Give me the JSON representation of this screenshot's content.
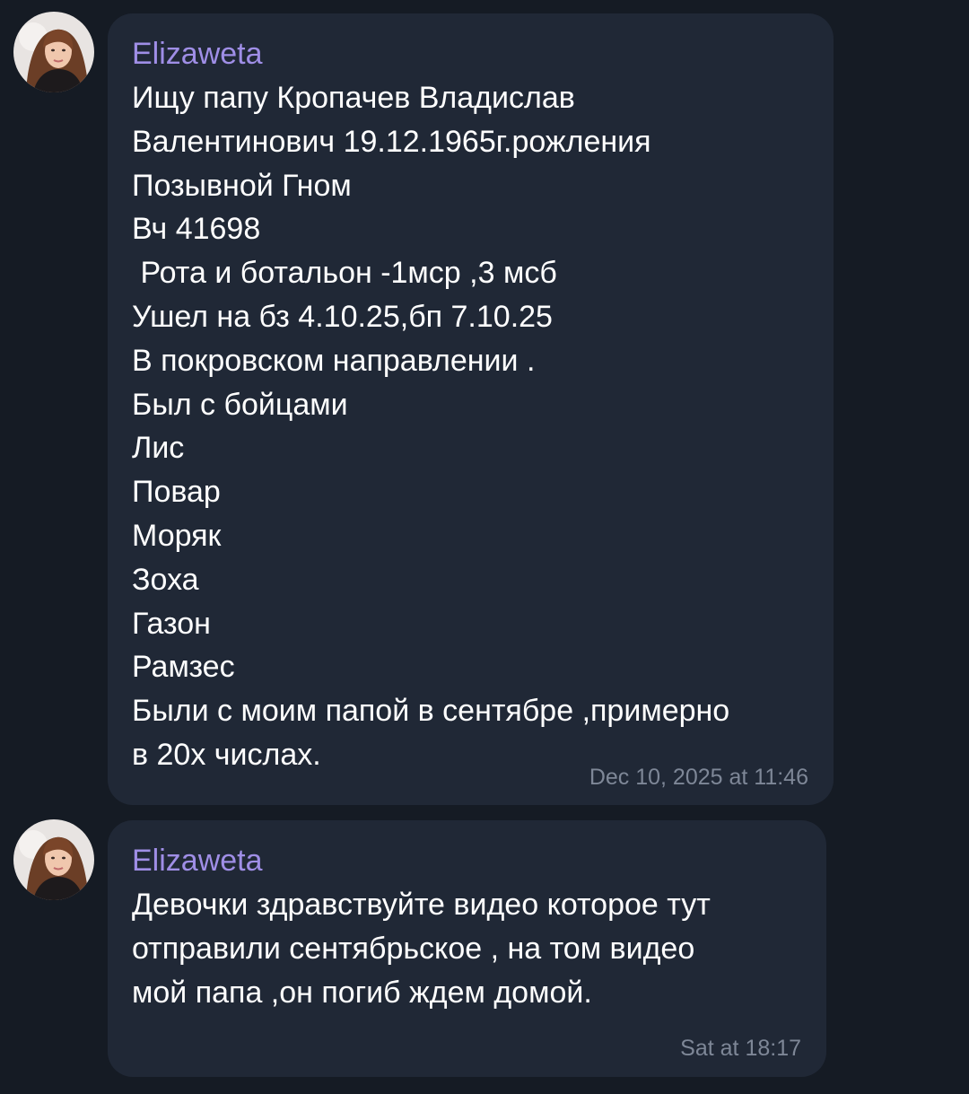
{
  "messages": [
    {
      "sender": "Elizaweta",
      "avatar_icon": "user-avatar-photo",
      "lines": [
        "Ищу папу Кропачев Владислав",
        "Валентинович 19.12.1965г.рожления",
        "Позывной Гном",
        "Вч 41698",
        " Рота и ботальон -1мср ,3 мсб",
        "Ушел на бз 4.10.25,бп 7.10.25",
        "В покровском направлении .",
        "Был с бойцами",
        "Лис",
        "Повар",
        "Моряк",
        "Зоха",
        "Газон",
        "Рамзес",
        "Были с моим папой в сентябре ,примерно",
        "в 20х числах."
      ],
      "time": "Dec 10, 2025 at 11:46"
    },
    {
      "sender": "Elizaweta",
      "avatar_icon": "user-avatar-photo",
      "lines": [
        "Девочки здравствуйте видео которое тут",
        "отправили сентябрьское , на том видео",
        "мой папа ,он погиб ждем домой."
      ],
      "time": "Sat at 18:17"
    }
  ],
  "colors": {
    "background": "#151b24",
    "bubble": "#202836",
    "sender_name": "#9f8ee6",
    "message_text": "#ffffff",
    "timestamp": "#7e8797"
  }
}
